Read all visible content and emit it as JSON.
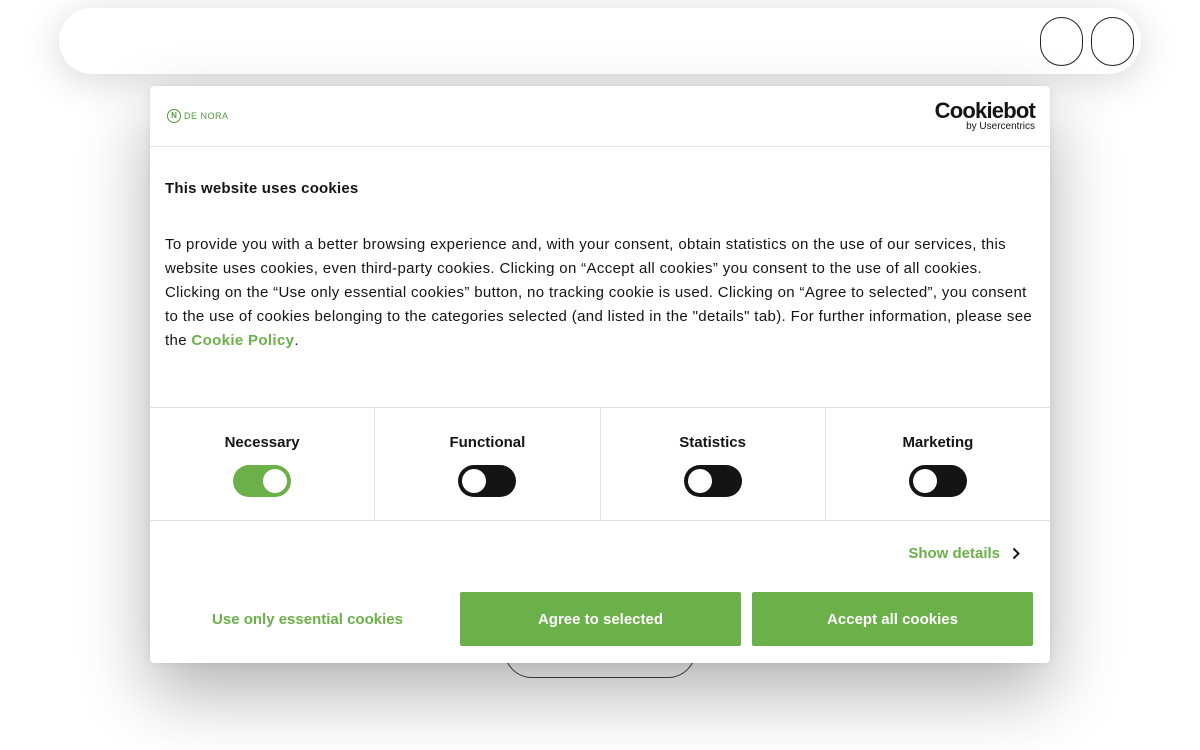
{
  "colors": {
    "accent": "#6bb048",
    "toggle_off": "#141414",
    "text": "#141414",
    "divider": "#e2e2e2"
  },
  "brand": {
    "mark": "N",
    "name": "DE NORA"
  },
  "cookiebot": {
    "logo_main": "Cookiebot",
    "logo_sub": "by Usercentrics"
  },
  "dialog": {
    "title": "This website uses cookies",
    "body_text": "To provide you with a better browsing experience and, with your consent, obtain statistics on the use of our services, this website uses cookies, even third-party cookies. Clicking on “Accept all cookies” you consent to the use of all cookies. Clicking on the “Use only essential cookies” button, no tracking cookie is used. Clicking on “Agree to selected”, you consent to the use of cookies belonging to the categories selected (and listed in the \"details\" tab). For further information, please see the ",
    "policy_link": "Cookie Policy",
    "body_end": "."
  },
  "categories": [
    {
      "label": "Necessary",
      "enabled": true
    },
    {
      "label": "Functional",
      "enabled": false
    },
    {
      "label": "Statistics",
      "enabled": false
    },
    {
      "label": "Marketing",
      "enabled": false
    }
  ],
  "show_details": {
    "label": "Show details",
    "icon": "chevron-right-icon"
  },
  "buttons": {
    "essential": "Use only essential cookies",
    "selected": "Agree to selected",
    "all": "Accept all cookies"
  }
}
